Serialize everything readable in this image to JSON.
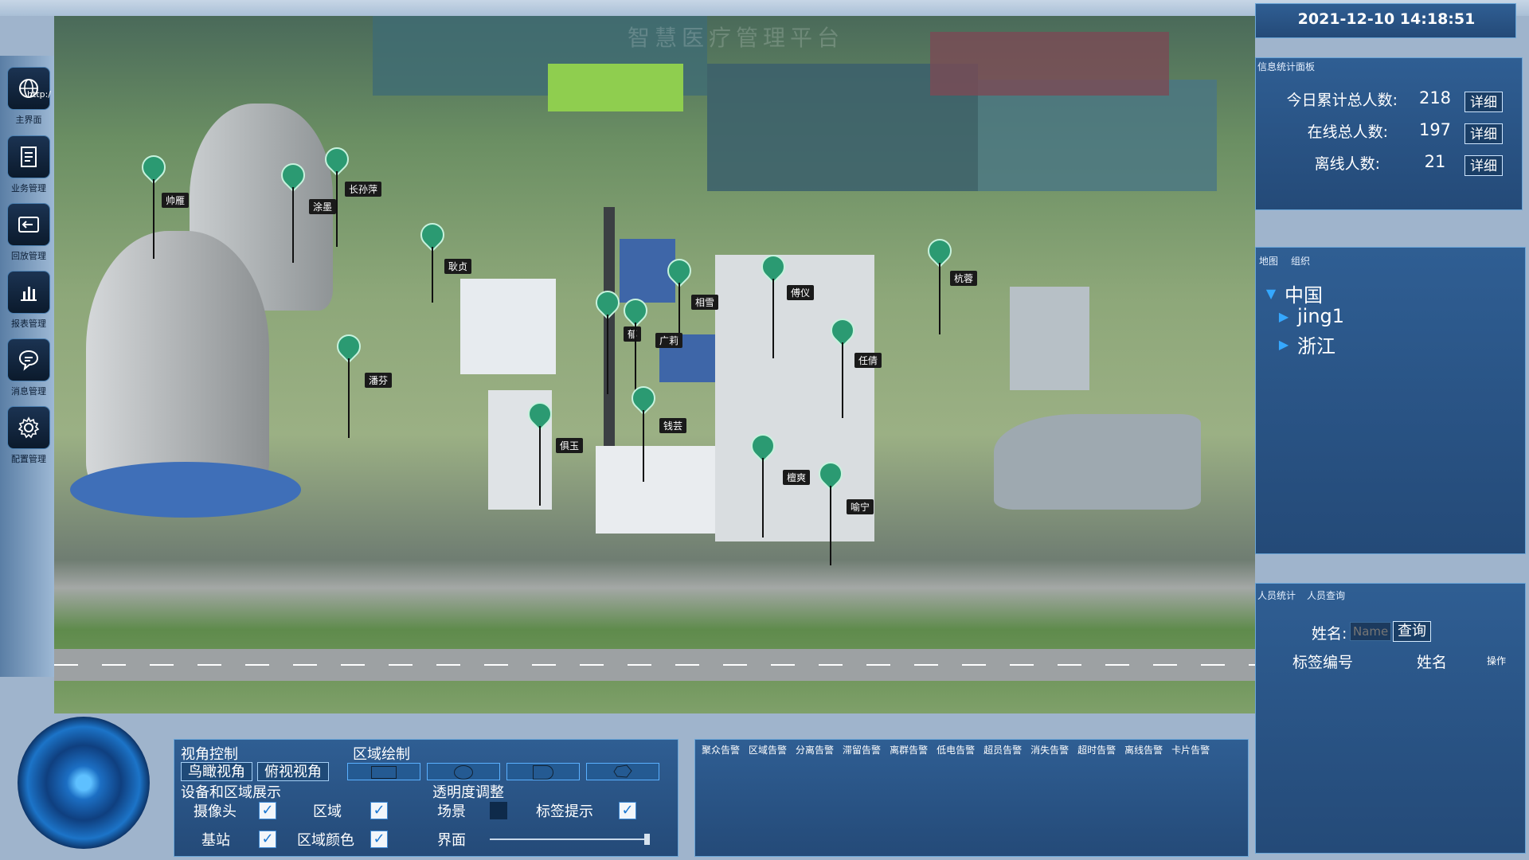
{
  "header": {
    "watermark": "智慧医疗管理平台",
    "datetime": "2021-12-10 14:18:51"
  },
  "leftnav": {
    "top_overlay": "http:/",
    "items": [
      {
        "label": "主界面",
        "icon": "globe-icon"
      },
      {
        "label": "业务管理",
        "icon": "document-icon"
      },
      {
        "label": "回放管理",
        "icon": "replay-icon"
      },
      {
        "label": "报表管理",
        "icon": "bar-chart-icon"
      },
      {
        "label": "消息管理",
        "icon": "message-icon"
      },
      {
        "label": "配置管理",
        "icon": "gear-icon"
      }
    ]
  },
  "map": {
    "pins": [
      {
        "name": "帅雁"
      },
      {
        "name": "涂墨"
      },
      {
        "name": "长孙萍"
      },
      {
        "name": "耿贞"
      },
      {
        "name": "潘芬"
      },
      {
        "name": "俱玉"
      },
      {
        "name": "郁"
      },
      {
        "name": "相雪"
      },
      {
        "name": "广莉"
      },
      {
        "name": "钱芸"
      },
      {
        "name": "傅仪"
      },
      {
        "name": "任倩"
      },
      {
        "name": "杭蓉"
      },
      {
        "name": "檀爽"
      },
      {
        "name": "喻宁"
      }
    ]
  },
  "stats_panel": {
    "title": "信息统计面板",
    "rows": [
      {
        "label": "今日累计总人数:",
        "value": "218",
        "button": "详细"
      },
      {
        "label": "在线总人数:",
        "value": "197",
        "button": "详细"
      },
      {
        "label": "离线人数:",
        "value": "21",
        "button": "详细"
      }
    ]
  },
  "tree_panel": {
    "tabs": [
      "地图",
      "组织"
    ],
    "nodes": [
      {
        "label": "中国",
        "expanded": true
      },
      {
        "label": "jing1",
        "expanded": false
      },
      {
        "label": "浙江",
        "expanded": false
      }
    ]
  },
  "person_panel": {
    "tabs": [
      "人员统计",
      "人员查询"
    ],
    "name_label": "姓名:",
    "name_placeholder": "Name",
    "query_button": "查询",
    "columns": [
      "标签编号",
      "姓名",
      "操作"
    ]
  },
  "controls": {
    "view_title": "视角控制",
    "birdseye_button": "鸟瞰视角",
    "topdown_button": "俯视视角",
    "draw_title": "区域绘制",
    "device_title": "设备和区域展示",
    "transparency_title": "透明度调整",
    "checks": [
      {
        "label": "摄像头",
        "checked": true
      },
      {
        "label": "区域",
        "checked": true
      },
      {
        "label": "场景",
        "checked": false
      },
      {
        "label": "标签提示",
        "checked": true
      },
      {
        "label": "基站",
        "checked": true
      },
      {
        "label": "区域颜色",
        "checked": true
      }
    ],
    "ui_label": "界面",
    "ui_opacity": 1.0
  },
  "alerts": {
    "tabs": [
      "聚众告警",
      "区域告警",
      "分离告警",
      "滞留告警",
      "离群告警",
      "低电告警",
      "超员告警",
      "消失告警",
      "超时告警",
      "离线告警",
      "卡片告警"
    ]
  }
}
